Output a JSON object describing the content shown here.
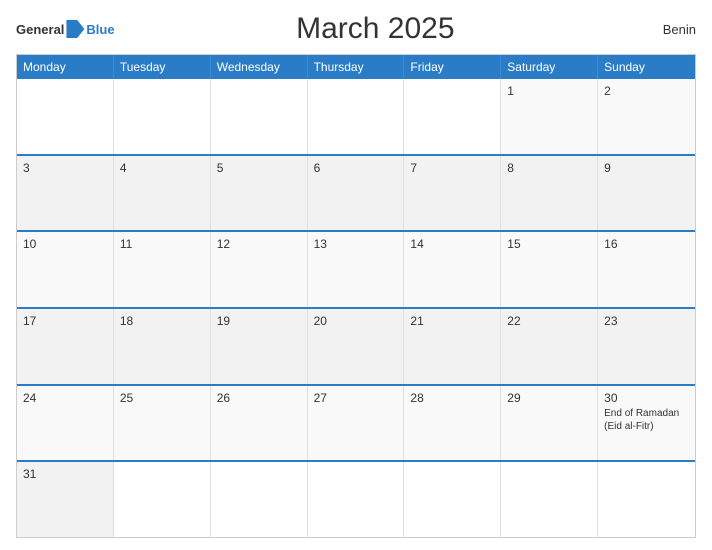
{
  "header": {
    "logo_general": "General",
    "logo_blue": "Blue",
    "title": "March 2025",
    "country": "Benin"
  },
  "calendar": {
    "days": [
      "Monday",
      "Tuesday",
      "Wednesday",
      "Thursday",
      "Friday",
      "Saturday",
      "Sunday"
    ],
    "rows": [
      [
        {
          "day": "",
          "empty": true
        },
        {
          "day": "",
          "empty": true
        },
        {
          "day": "",
          "empty": true
        },
        {
          "day": "",
          "empty": true
        },
        {
          "day": "",
          "empty": true
        },
        {
          "day": "1",
          "empty": false
        },
        {
          "day": "2",
          "empty": false
        }
      ],
      [
        {
          "day": "3",
          "empty": false
        },
        {
          "day": "4",
          "empty": false
        },
        {
          "day": "5",
          "empty": false
        },
        {
          "day": "6",
          "empty": false
        },
        {
          "day": "7",
          "empty": false
        },
        {
          "day": "8",
          "empty": false
        },
        {
          "day": "9",
          "empty": false
        }
      ],
      [
        {
          "day": "10",
          "empty": false
        },
        {
          "day": "11",
          "empty": false
        },
        {
          "day": "12",
          "empty": false
        },
        {
          "day": "13",
          "empty": false
        },
        {
          "day": "14",
          "empty": false
        },
        {
          "day": "15",
          "empty": false
        },
        {
          "day": "16",
          "empty": false
        }
      ],
      [
        {
          "day": "17",
          "empty": false
        },
        {
          "day": "18",
          "empty": false
        },
        {
          "day": "19",
          "empty": false
        },
        {
          "day": "20",
          "empty": false
        },
        {
          "day": "21",
          "empty": false
        },
        {
          "day": "22",
          "empty": false
        },
        {
          "day": "23",
          "empty": false
        }
      ],
      [
        {
          "day": "24",
          "empty": false
        },
        {
          "day": "25",
          "empty": false
        },
        {
          "day": "26",
          "empty": false
        },
        {
          "day": "27",
          "empty": false
        },
        {
          "day": "28",
          "empty": false
        },
        {
          "day": "29",
          "empty": false
        },
        {
          "day": "30",
          "empty": false,
          "event": "End of Ramadan (Eid al-Fitr)"
        }
      ],
      [
        {
          "day": "31",
          "empty": false
        },
        {
          "day": "",
          "empty": true
        },
        {
          "day": "",
          "empty": true
        },
        {
          "day": "",
          "empty": true
        },
        {
          "day": "",
          "empty": true
        },
        {
          "day": "",
          "empty": true
        },
        {
          "day": "",
          "empty": true
        }
      ]
    ]
  }
}
